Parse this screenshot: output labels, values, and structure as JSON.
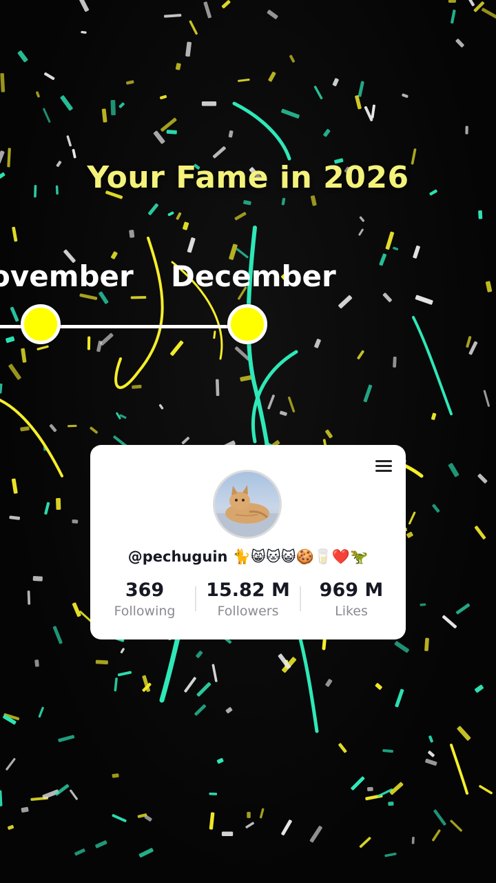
{
  "title": "Your Fame in 2026",
  "timeline": {
    "months": [
      "ovember",
      "December"
    ]
  },
  "profile": {
    "handle": "@pechuguin 🐈😸🐱😺🍪🥛❤️🦖",
    "stats": {
      "following": {
        "value": "369",
        "label": "Following"
      },
      "followers": {
        "value": "15.82 M",
        "label": "Followers"
      },
      "likes": {
        "value": "969 M",
        "label": "Likes"
      }
    }
  },
  "colors": {
    "title": "#f4f27a",
    "dot": "#ffff00",
    "confetti": [
      "#f5ee2a",
      "#2ee8b8",
      "#e8e8e8"
    ]
  },
  "icons": {
    "menu": "hamburger-menu-icon",
    "avatar": "cat-photo"
  }
}
